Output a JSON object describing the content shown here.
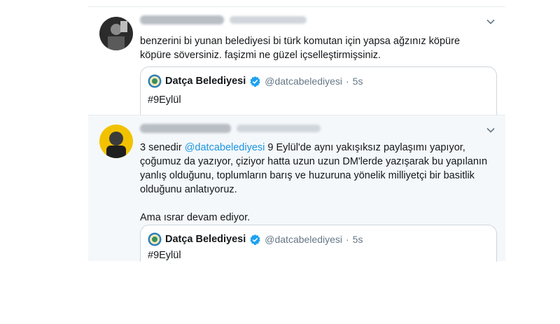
{
  "tweets": [
    {
      "text": "benzerini bi yunan belediyesi bi türk komutan için yapsa ağzınız köpüre\nköpüre sövers­iniz. faşizmi ne güzel içselleştirmişsiniz.",
      "quote": {
        "name": "Datça Belediyesi",
        "handle": "@datcabelediyesi",
        "dot": "·",
        "time": "5s",
        "text": "#9Eylül"
      }
    },
    {
      "text_before": "3 senedir ",
      "mention": "@datcabelediyesi",
      "text_after": " 9 Eylül'de aynı yakışıksız paylaşımı yapıyor,\nçoğumuz da yazıyor, çiziyor hatta uzun uzun DM'lerde yazışarak bu yapılanın\nyanlış olduğunu, toplumların barış ve huzuruna yönelik milliyetçi bir basitlik\nolduğunu anlatıyoruz.\n\nAma ısrar devam ediyor.",
      "quote": {
        "name": "Datça Belediyesi",
        "handle": "@datcabelediyesi",
        "dot": "·",
        "time": "5s",
        "text": "#9Eylül"
      }
    }
  ],
  "icons": {
    "caret": "chevron-down-icon",
    "verified": "verified-badge-icon",
    "logo": "municipality-logo-icon"
  },
  "colors": {
    "mention": "#1b95e0",
    "verified": "#1da1f2",
    "secondary_text": "#657786",
    "selected_bg": "#f5f8fa"
  }
}
